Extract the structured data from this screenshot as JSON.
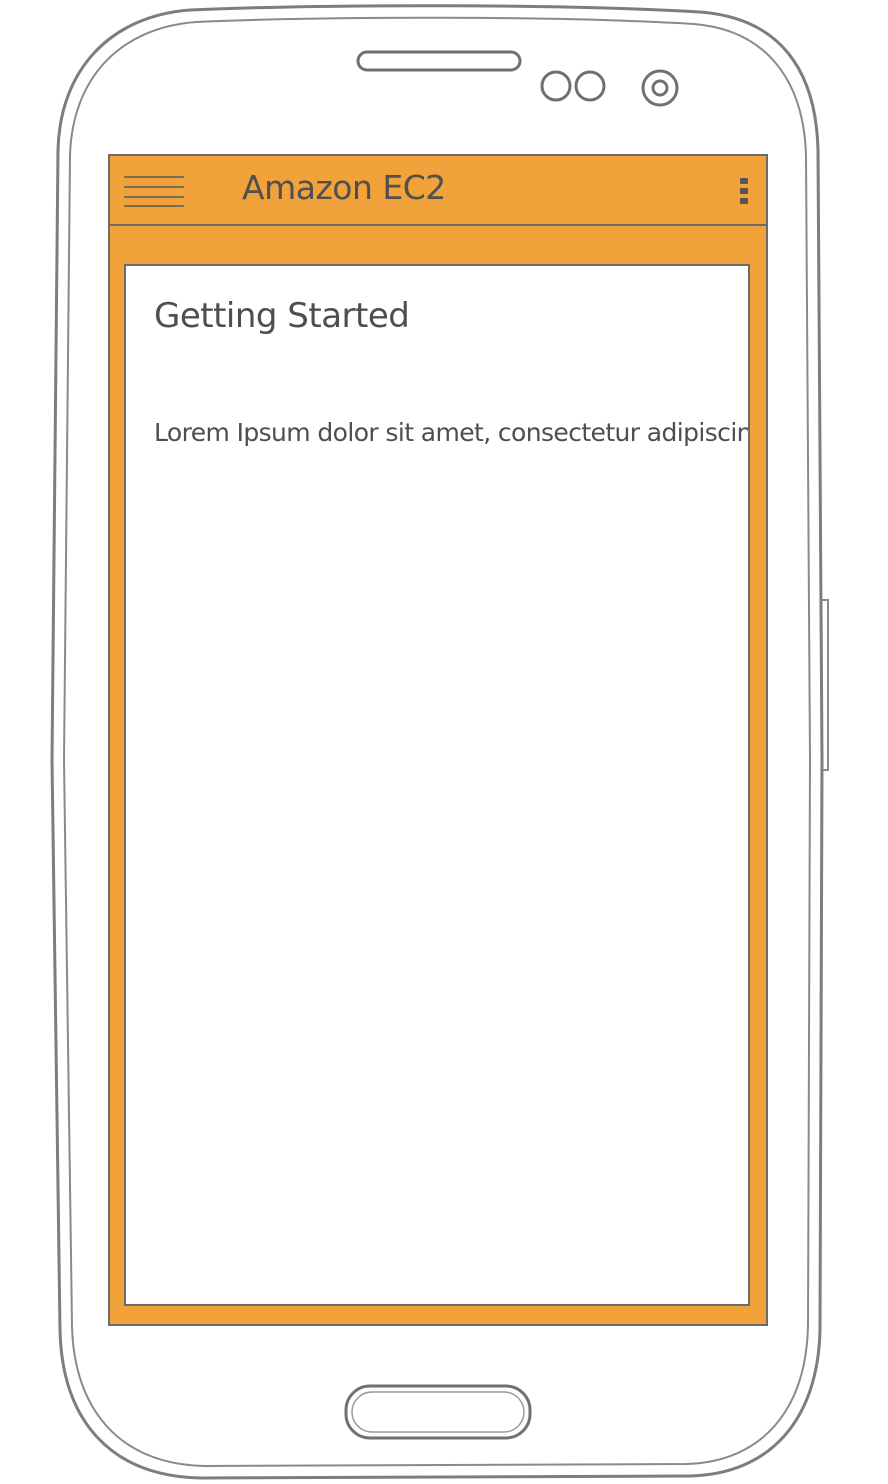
{
  "app": {
    "title": "Amazon EC2",
    "accent_color": "#f2a23a"
  },
  "toolbar": {
    "menu_icon": "hamburger-menu-icon",
    "overflow_icon": "vertical-ellipsis-icon"
  },
  "content": {
    "heading": "Getting Started",
    "body": "Lorem Ipsum dolor sit amet, consectetur adipiscing"
  },
  "device": {
    "home_button_icon": "home-button",
    "camera_icon": "front-camera-icon",
    "speaker_icon": "earpiece-speaker-icon"
  }
}
